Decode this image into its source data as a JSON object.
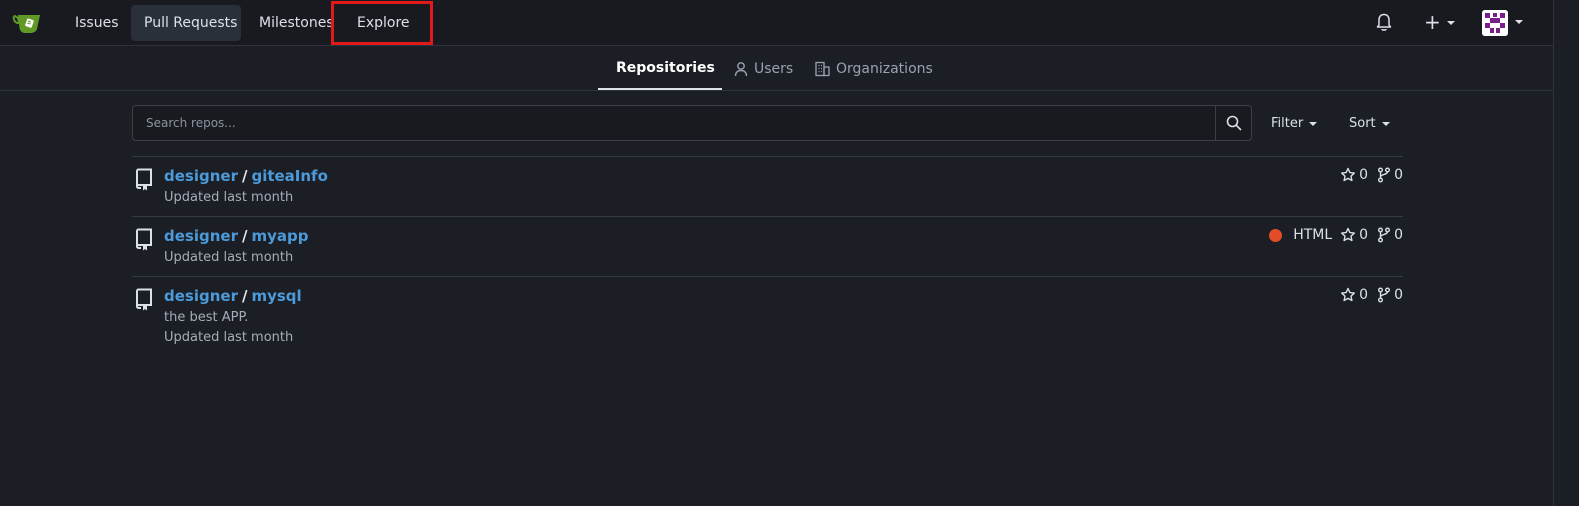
{
  "navbar": {
    "items": [
      {
        "label": "Issues"
      },
      {
        "label": "Pull Requests"
      },
      {
        "label": "Milestones"
      },
      {
        "label": "Explore"
      }
    ],
    "icons": {
      "logo": "gitea-logo",
      "notifications": "bell-icon",
      "create": "plus-icon",
      "user": "avatar"
    }
  },
  "subnav": {
    "tabs": [
      {
        "label": "Repositories",
        "icon": "repo-icon"
      },
      {
        "label": "Users",
        "icon": "person-icon"
      },
      {
        "label": "Organizations",
        "icon": "organization-icon"
      }
    ]
  },
  "search": {
    "placeholder": "Search repos...",
    "value": "",
    "filter_label": "Filter",
    "sort_label": "Sort"
  },
  "repos": [
    {
      "owner": "designer",
      "name": "giteaInfo",
      "description": "",
      "updated": "Updated last month",
      "language": "",
      "stars": "0",
      "forks": "0"
    },
    {
      "owner": "designer",
      "name": "myapp",
      "description": "",
      "updated": "Updated last month",
      "language": "HTML",
      "stars": "0",
      "forks": "0"
    },
    {
      "owner": "designer",
      "name": "mysql",
      "description": "the best APP.",
      "updated": "Updated last month",
      "language": "",
      "stars": "0",
      "forks": "0"
    }
  ],
  "colors": {
    "background": "#1b1e24",
    "link": "#4c9ad9",
    "html_language": "#e34c26",
    "highlight": "#e0191b"
  }
}
